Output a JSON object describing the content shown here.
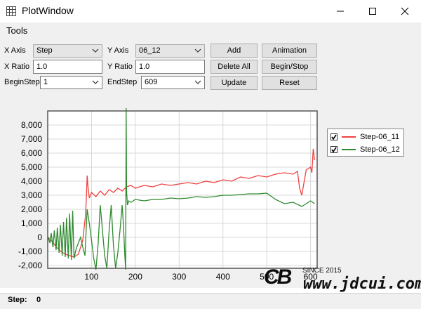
{
  "window": {
    "title": "PlotWindow"
  },
  "menu": {
    "items": [
      "Tools"
    ]
  },
  "controls": {
    "x_axis_label": "X Axis",
    "x_axis_value": "Step",
    "y_axis_label": "Y Axis",
    "y_axis_value": "06_12",
    "x_ratio_label": "X Ratio",
    "x_ratio_value": "1.0",
    "y_ratio_label": "Y Ratio",
    "y_ratio_value": "1.0",
    "begin_step_label": "BeginStep",
    "begin_step_value": "1",
    "end_step_label": "EndStep",
    "end_step_value": "609",
    "add_label": "Add",
    "delete_all_label": "Delete All",
    "update_label": "Update",
    "animation_label": "Animation",
    "begin_stop_label": "Begin/Stop",
    "reset_label": "Reset"
  },
  "status": {
    "label": "Step:",
    "value": "0"
  },
  "watermark": {
    "logo": "CB",
    "since": "SINCE 2015",
    "url": "www.jdcui.com"
  },
  "colors": {
    "series_red": "#f04040",
    "series_green": "#2f8a2f",
    "grid": "#d8d8d8",
    "panel": "#f0f0f0"
  },
  "chart_data": {
    "type": "line",
    "xlim": [
      0,
      615
    ],
    "ylim": [
      -2200,
      9000
    ],
    "x_ticks": [
      100,
      200,
      300,
      400,
      500,
      600
    ],
    "y_ticks": [
      -2000,
      -1000,
      0,
      1000,
      2000,
      3000,
      4000,
      5000,
      6000,
      7000,
      8000
    ],
    "x_tick_labels": [
      "100",
      "200",
      "300",
      "400",
      "500",
      "600"
    ],
    "y_tick_labels": [
      "-2,000",
      "-1,000",
      "0",
      "1,000",
      "2,000",
      "3,000",
      "4,000",
      "5,000",
      "6,000",
      "7,000",
      "8,000"
    ],
    "grid": true,
    "legend": "right",
    "series": [
      {
        "name": "Step-06_11",
        "color": "#f04040",
        "x": [
          1,
          10,
          20,
          30,
          40,
          50,
          60,
          70,
          80,
          86,
          88,
          90,
          92,
          95,
          100,
          110,
          120,
          130,
          140,
          150,
          160,
          170,
          180,
          190,
          200,
          220,
          240,
          260,
          280,
          300,
          320,
          340,
          360,
          380,
          400,
          420,
          440,
          460,
          480,
          500,
          520,
          540,
          560,
          570,
          575,
          580,
          590,
          600,
          603,
          606,
          609
        ],
        "y": [
          0,
          -300,
          -700,
          -1000,
          -1200,
          -1300,
          -1400,
          -1200,
          -200,
          1500,
          2600,
          4400,
          3600,
          2800,
          3200,
          2900,
          3300,
          3000,
          3400,
          3200,
          3500,
          3300,
          3600,
          3700,
          3500,
          3700,
          3600,
          3800,
          3700,
          3800,
          3900,
          3800,
          4000,
          3900,
          4100,
          4000,
          4300,
          4200,
          4400,
          4300,
          4500,
          4600,
          4500,
          4700,
          3500,
          3000,
          4800,
          5000,
          4600,
          6300,
          5500
        ]
      },
      {
        "name": "Step-06_12",
        "color": "#2f8a2f",
        "x": [
          1,
          5,
          8,
          12,
          15,
          19,
          22,
          26,
          29,
          33,
          36,
          40,
          43,
          47,
          50,
          54,
          57,
          60,
          65,
          70,
          75,
          80,
          85,
          90,
          95,
          100,
          105,
          110,
          115,
          120,
          125,
          130,
          135,
          140,
          145,
          150,
          155,
          160,
          165,
          170,
          173,
          176,
          178,
          179,
          180,
          182,
          185,
          190,
          200,
          220,
          240,
          260,
          280,
          300,
          320,
          340,
          360,
          380,
          400,
          420,
          440,
          460,
          480,
          500,
          520,
          540,
          560,
          580,
          600,
          609
        ],
        "y": [
          0,
          -400,
          300,
          -700,
          500,
          -900,
          700,
          -1100,
          900,
          -1300,
          1100,
          -1400,
          1400,
          -1500,
          1700,
          -1600,
          1900,
          -1500,
          -800,
          -400,
          0,
          -700,
          -1300,
          2000,
          1000,
          -200,
          -1500,
          -2300,
          -500,
          2300,
          500,
          -1300,
          -2200,
          400,
          2300,
          -600,
          -2200,
          -1100,
          500,
          2300,
          800,
          -1300,
          -2300,
          9200,
          3300,
          2300,
          2600,
          2500,
          2700,
          2600,
          2700,
          2700,
          2800,
          2750,
          2800,
          2900,
          2850,
          2900,
          3000,
          3000,
          3050,
          3100,
          3100,
          3150,
          2700,
          2400,
          2500,
          2200,
          2600,
          2400
        ]
      }
    ]
  }
}
